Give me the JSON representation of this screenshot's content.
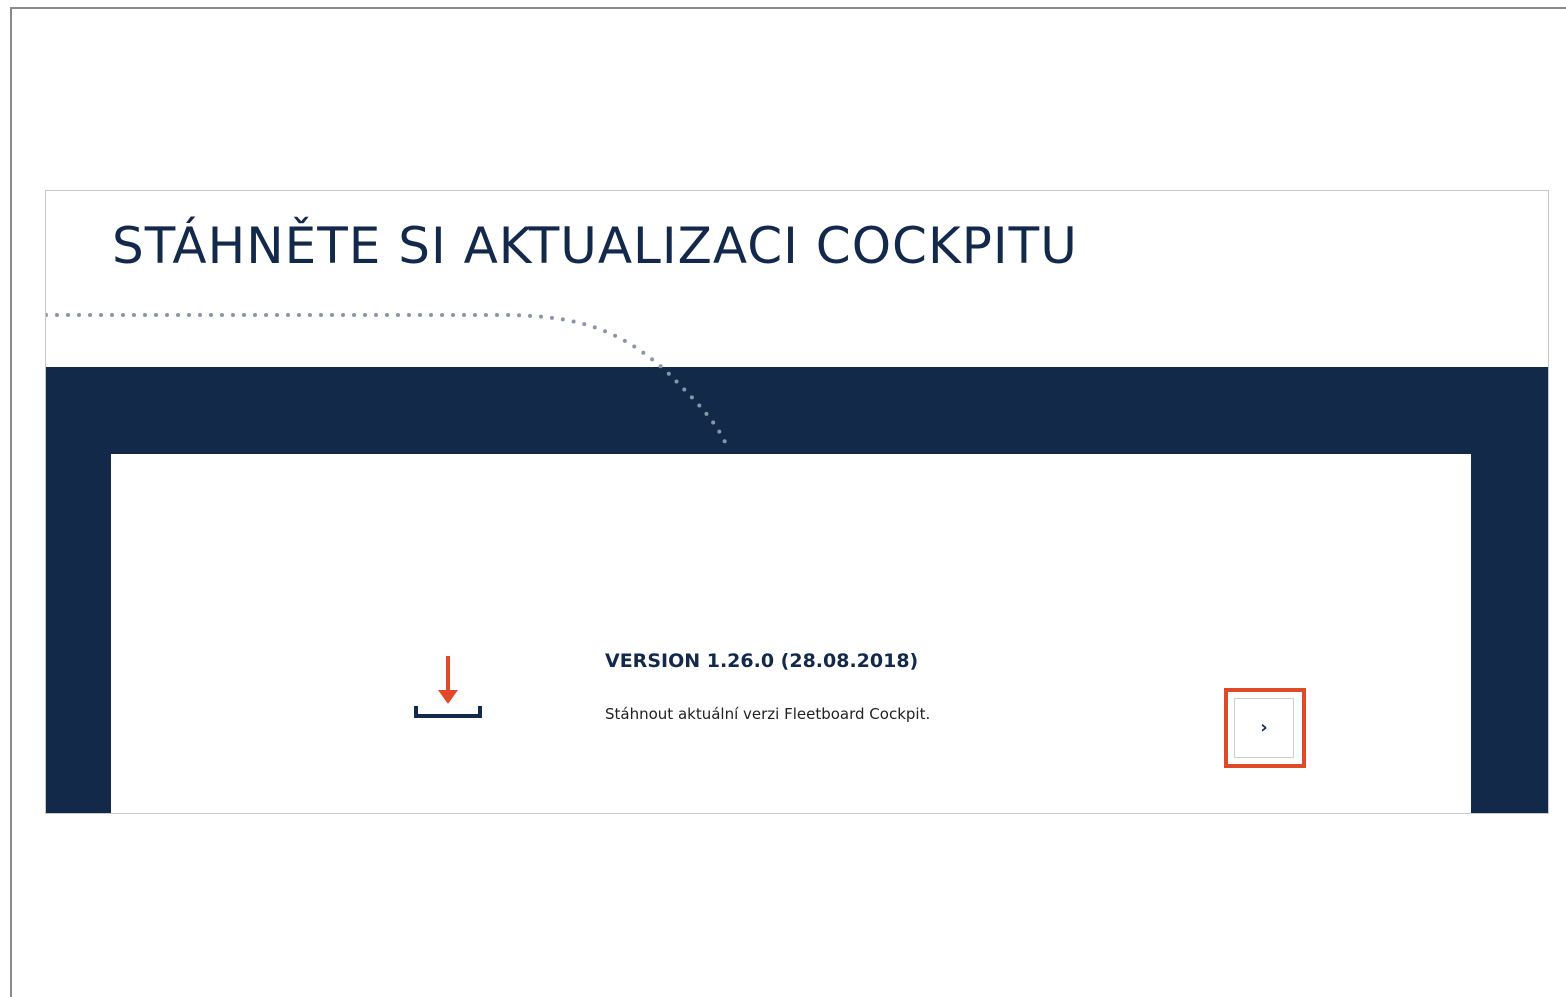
{
  "page": {
    "title": "STÁHNĚTE SI AKTUALIZACI COCKPITU"
  },
  "download_card": {
    "version_title": "VERSION 1.26.0 (28.08.2018)",
    "description": "Stáhnout aktuální verzi Fleetboard Cockpit.",
    "icon": "download-icon",
    "button_icon": "chevron-right-icon",
    "button_glyph": "›"
  },
  "colors": {
    "navy": "#12294a",
    "accent_red": "#e04a2b",
    "dots": "#8a96a8",
    "title_text": "#13294b"
  }
}
